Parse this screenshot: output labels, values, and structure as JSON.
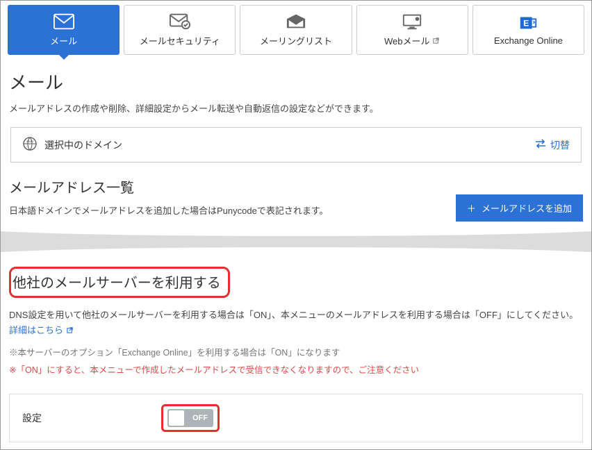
{
  "tabs": [
    {
      "label": "メール",
      "active": true
    },
    {
      "label": "メールセキュリティ",
      "active": false
    },
    {
      "label": "メーリングリスト",
      "active": false
    },
    {
      "label": "Webメール",
      "active": false,
      "external": true
    },
    {
      "label": "Exchange Online",
      "active": false
    }
  ],
  "page": {
    "title": "メール",
    "description": "メールアドレスの作成や削除、詳細設定からメール転送や自動返信の設定などができます。"
  },
  "domain": {
    "label": "選択中のドメイン",
    "switch_label": "切替"
  },
  "address_list": {
    "title": "メールアドレス一覧",
    "description": "日本語ドメインでメールアドレスを追加した場合はPunycodeで表記されます。",
    "add_button": "メールアドレスを追加"
  },
  "other_server": {
    "title": "他社のメールサーバーを利用する",
    "text_prefix": "DNS設定を用いて他社のメールサーバーを利用する場合は「ON」、本メニューのメールアドレスを利用する場合は「OFF」にしてください。",
    "link": "詳細はこちら",
    "note1": "※本サーバーのオプション「Exchange Online」を利用する場合は「ON」になります",
    "note2": "※「ON」にすると、本メニューで作成したメールアドレスで受信できなくなりますので、ご注意ください",
    "setting_label": "設定",
    "toggle_value": "OFF"
  }
}
